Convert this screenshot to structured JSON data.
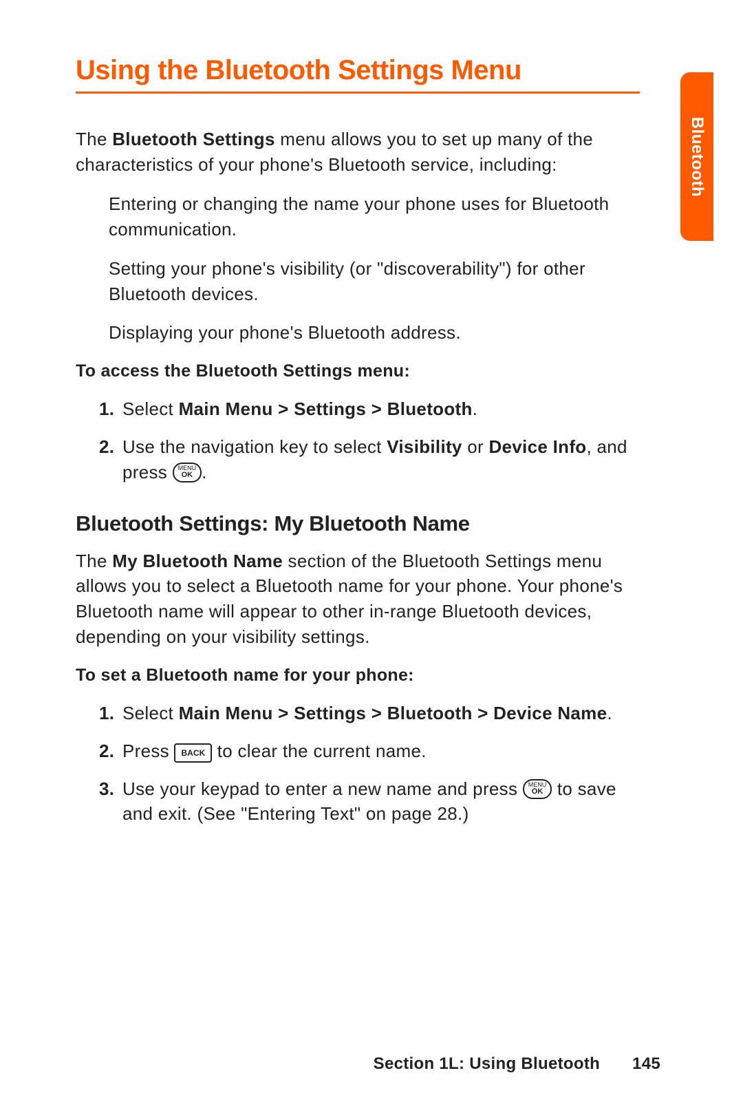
{
  "title": "Using the Bluetooth Settings Menu",
  "side_tab": "Bluetooth",
  "intro": {
    "pre": "The ",
    "bold": "Bluetooth Settings",
    "post": " menu allows you to set up many of the characteristics of your phone's Bluetooth service, including:"
  },
  "bullets": [
    "Entering or changing the name your phone uses for Bluetooth communication.",
    "Setting your phone's visibility (or \"discoverability\") for other Bluetooth devices.",
    "Displaying your phone's Bluetooth address."
  ],
  "access_heading": "To access the Bluetooth Settings menu:",
  "steps1": {
    "s1_pre": "Select ",
    "s1_bold": "Main Menu > Settings > Bluetooth",
    "s1_post": ".",
    "s2_pre": "Use the navigation key to select ",
    "s2_b1": "Visibility",
    "s2_mid": " or ",
    "s2_b2": "Device Info",
    "s2_after": ", and press ",
    "s2_post": "."
  },
  "h2": "Bluetooth Settings: My Bluetooth Name",
  "para2": {
    "pre": "The ",
    "bold": "My Bluetooth Name",
    "post": " section of the Bluetooth Settings menu allows you to select a Bluetooth name for your phone. Your phone's Bluetooth name will appear to other in-range Bluetooth devices, depending on your visibility settings."
  },
  "set_heading": "To set a Bluetooth name for your phone:",
  "steps2": {
    "s1_pre": "Select ",
    "s1_bold": "Main Menu > Settings > Bluetooth > Device Name",
    "s1_post": ".",
    "s2_pre": "Press ",
    "s2_post": " to clear the current name.",
    "s3_pre": "Use your keypad to enter a new name and press ",
    "s3_post": " to save and exit. (See \"Entering Text\" on page 28.)"
  },
  "key_menu_l1": "MENU",
  "key_menu_l2": "OK",
  "key_back": "BACK",
  "footer_section": "Section 1L: Using Bluetooth",
  "footer_page": "145"
}
